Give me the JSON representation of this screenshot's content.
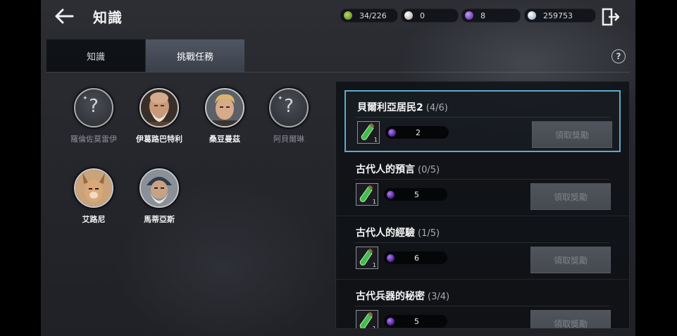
{
  "header": {
    "title": "知識",
    "resources": [
      {
        "name": "leaf-token-icon",
        "value": "34/226",
        "color": "#8fb33a"
      },
      {
        "name": "pearl-icon",
        "value": "0",
        "color": "#d8cfc4"
      },
      {
        "name": "purple-orb-icon",
        "value": "8",
        "color": "#7a3fd0"
      },
      {
        "name": "silver-coin-icon",
        "value": "259753",
        "color": "#b8c6d8"
      }
    ]
  },
  "tabs": [
    {
      "label": "知識",
      "active": false
    },
    {
      "label": "挑戰任務",
      "active": true
    }
  ],
  "help_label": "?",
  "characters": [
    {
      "name": "羅倫佐莫雷伊",
      "unlocked": false,
      "portrait": "unknown-portrait"
    },
    {
      "name": "伊葛路巴特利",
      "unlocked": true,
      "portrait": "bald-old-man-portrait"
    },
    {
      "name": "桑豆曼茲",
      "unlocked": true,
      "portrait": "blond-man-portrait"
    },
    {
      "name": "阿貝爾琳",
      "unlocked": false,
      "portrait": "unknown-portrait"
    },
    {
      "name": "艾路尼",
      "unlocked": true,
      "portrait": "beastkin-portrait"
    },
    {
      "name": "馬蒂亞斯",
      "unlocked": true,
      "portrait": "old-wizard-portrait"
    }
  ],
  "unknown_mark": "?",
  "quests": [
    {
      "title": "貝爾利亞居民2",
      "progress": "(4/6)",
      "reward_value": "2",
      "item_count": "1",
      "claim_label": "領取獎勵",
      "selected": true
    },
    {
      "title": "古代人的預言",
      "progress": "(0/5)",
      "reward_value": "5",
      "item_count": "1",
      "claim_label": "領取獎勵",
      "selected": false
    },
    {
      "title": "古代人的經驗",
      "progress": "(1/5)",
      "reward_value": "6",
      "item_count": "1",
      "claim_label": "領取獎勵",
      "selected": false
    },
    {
      "title": "古代兵器的秘密",
      "progress": "(3/4)",
      "reward_value": "5",
      "item_count": "1",
      "claim_label": "領取獎勵",
      "selected": false
    }
  ],
  "colors": {
    "selection_border": "#5fa9cc",
    "active_tab": "#4f5662"
  }
}
